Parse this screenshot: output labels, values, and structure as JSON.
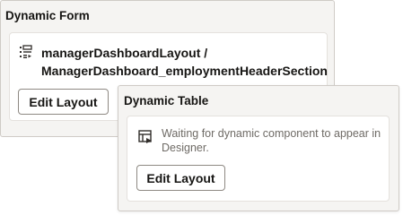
{
  "dynamic_form": {
    "title": "Dynamic Form",
    "layout_name": "managerDashboardLayout / ManagerDashboard_employmentHeaderSection",
    "layout_icon": "layout-list-icon",
    "edit_button_label": "Edit Layout"
  },
  "dynamic_table": {
    "title": "Dynamic Table",
    "message": "Waiting for dynamic component to appear in Designer.",
    "message_icon": "table-layout-icon",
    "edit_button_label": "Edit Layout"
  }
}
